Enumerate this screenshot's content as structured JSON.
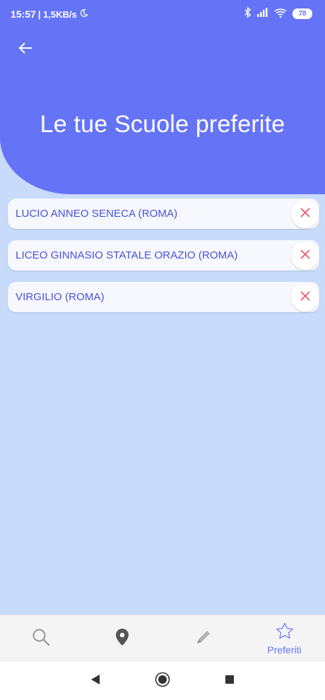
{
  "status_bar": {
    "time": "15:57",
    "network_speed": "| 1,5KB/s",
    "battery_level": "78",
    "icons": [
      "moon-icon",
      "bluetooth-icon",
      "signal-icon",
      "wifi-icon",
      "battery-icon"
    ]
  },
  "app_bar": {
    "back_icon": "arrow-left-icon"
  },
  "header": {
    "title": "Le tue Scuole preferite"
  },
  "favorites": [
    {
      "name": "LUCIO ANNEO SENECA (ROMA)"
    },
    {
      "name": "LICEO GINNASIO STATALE ORAZIO (ROMA)"
    },
    {
      "name": "VIRGILIO (ROMA)"
    }
  ],
  "bottom_nav": {
    "items": [
      {
        "icon": "search-icon",
        "label": ""
      },
      {
        "icon": "map-pin-icon",
        "label": ""
      },
      {
        "icon": "pencil-icon",
        "label": ""
      },
      {
        "icon": "star-icon",
        "label": "Preferiti"
      }
    ]
  },
  "colors": {
    "primary": "#6574f6",
    "background": "#c9dbfb",
    "item_text": "#4a4fd9",
    "remove": "#e8566e",
    "nav_inactive": "#9e9e9e"
  }
}
